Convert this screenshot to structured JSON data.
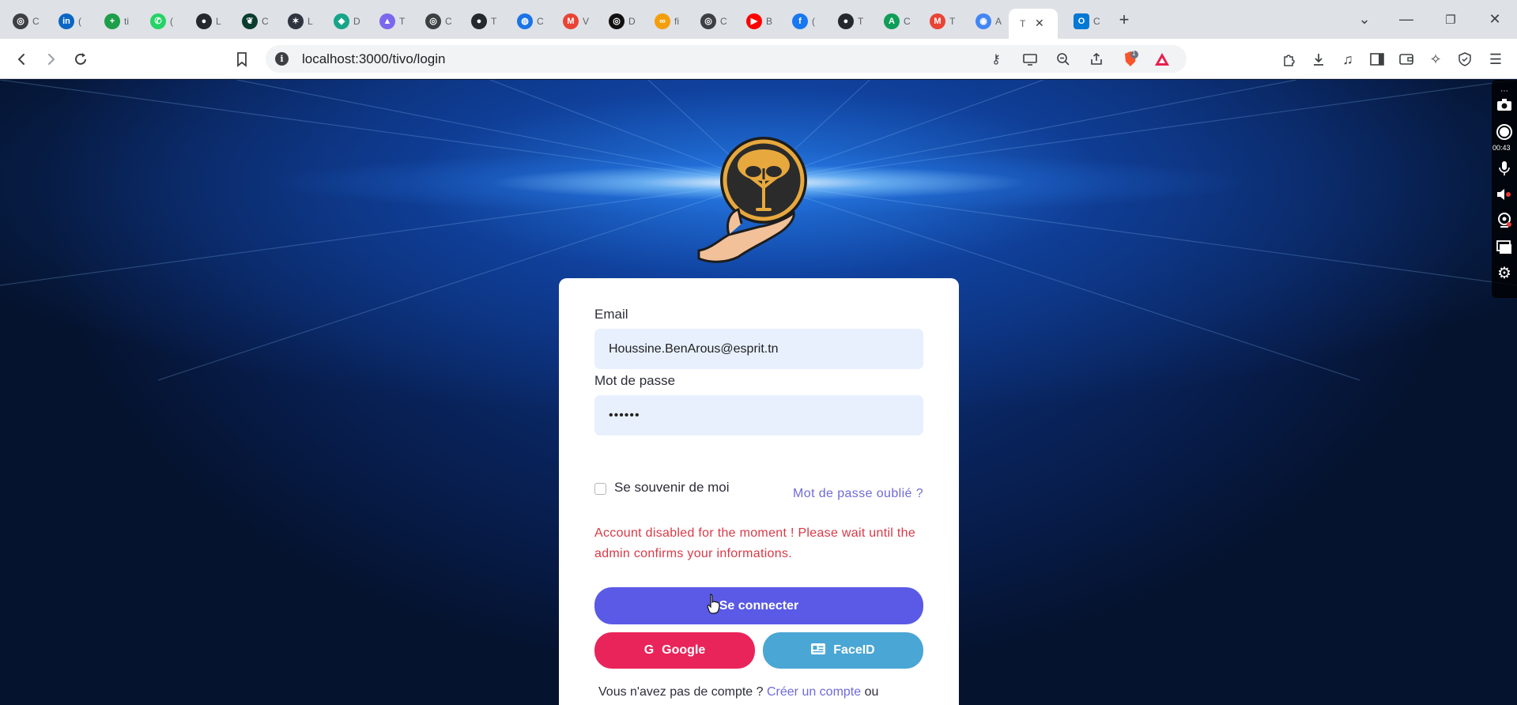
{
  "browser": {
    "tabs": [
      {
        "icon": "openai-icon",
        "title": "C",
        "color": "#3c4043"
      },
      {
        "icon": "linkedin-icon",
        "title": "(",
        "color": "#0a66c2"
      },
      {
        "icon": "plus-circle-icon",
        "title": "ti",
        "color": "#1e9e4a"
      },
      {
        "icon": "whatsapp-icon",
        "title": "(",
        "color": "#25d366"
      },
      {
        "icon": "github-icon",
        "title": "L",
        "color": "#24292f"
      },
      {
        "icon": "mongodb-icon",
        "title": "C",
        "color": "#0b3d2e"
      },
      {
        "icon": "slack-icon",
        "title": "L",
        "color": "#2e3440"
      },
      {
        "icon": "diamond-icon",
        "title": "D",
        "color": "#16a589"
      },
      {
        "icon": "clickup-icon",
        "title": "T",
        "color": "#7b68ee"
      },
      {
        "icon": "openai-icon",
        "title": "C",
        "color": "#3c4043"
      },
      {
        "icon": "github-icon",
        "title": "T",
        "color": "#24292f"
      },
      {
        "icon": "globe-icon",
        "title": "C",
        "color": "#1a73e8"
      },
      {
        "icon": "gmail-icon",
        "title": "V",
        "color": "#ea4335"
      },
      {
        "icon": "openai-icon",
        "title": "D",
        "color": "#111111"
      },
      {
        "icon": "coin-icon",
        "title": "fi",
        "color": "#f59e0b"
      },
      {
        "icon": "openai-icon",
        "title": "C",
        "color": "#3c4043"
      },
      {
        "icon": "youtube-icon",
        "title": "B",
        "color": "#ff0000"
      },
      {
        "icon": "facebook-icon",
        "title": "(",
        "color": "#1877f2"
      },
      {
        "icon": "github-icon",
        "title": "T",
        "color": "#24292f"
      },
      {
        "icon": "app-a-icon",
        "title": "C",
        "color": "#0f9d58"
      },
      {
        "icon": "gmail-icon",
        "title": "T",
        "color": "#ea4335"
      },
      {
        "icon": "chrome-icon",
        "title": "A",
        "color": "#4285f4"
      }
    ],
    "active_tab": {
      "title": "T",
      "close": "✕"
    },
    "extra_tab": {
      "icon": "outlook-icon",
      "title": "C",
      "color": "#0078d4"
    },
    "new_tab": "+",
    "url": "localhost:3000/tivo/login",
    "info_glyph": "i",
    "badge_count": "1"
  },
  "recorder": {
    "timer": "00:43"
  },
  "login": {
    "email_label": "Email",
    "email_value": "Houssine.BenArous@esprit.tn",
    "password_label": "Mot de passe",
    "password_value": "••••••",
    "remember_label": "Se souvenir de moi",
    "forgot_link": "Mot de passe oublié ?",
    "error_message": "Account disabled for the moment ! Please wait until the admin confirms your informations.",
    "login_button": "Se connecter",
    "google_button": "Google",
    "faceid_button": "FaceID",
    "footer_prefix": "Vous n'avez pas de compte ?",
    "footer_link": "Créer un compte",
    "footer_suffix": "ou"
  },
  "colors": {
    "primary": "#5a5ae6",
    "google": "#e9245a",
    "faceid": "#4aa6d4",
    "error": "#d93846",
    "link": "#6e6ad8"
  }
}
